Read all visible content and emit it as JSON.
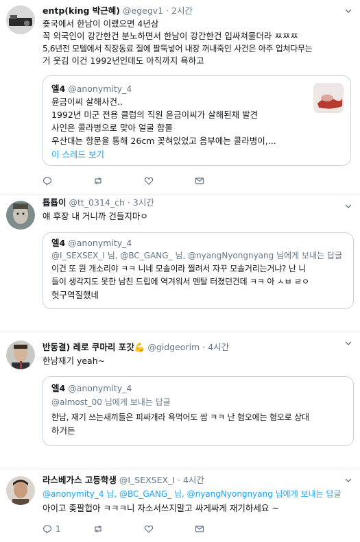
{
  "tweets": [
    {
      "name": "entp(king 박근혜)",
      "handle": "@egegv1",
      "time": "2시간",
      "lines": [
        "죶국에서 한남이 이랬으면 4년삼",
        "꼭 외국인이 강간한건 분노하면서 한남이 강간한건 입싸쳐물더라 ㅉㅉㅉ",
        "5,6년전 모텔에서 직장동료 질에 팔뚝넣어 내장 꺼내죽인 사건은 아주 입쳐다무는",
        "거 웃김 이건 1992년인데도 아직까지 욕하고"
      ],
      "quote": {
        "name": "엘4",
        "handle": "@anonymity_4",
        "lines": [
          "윤금이씨 살해사건..",
          "1992년 미군 전용 클럽의 직원 윤금이씨가 살해된채 발견",
          "사인은 콜라병으로 맞아 얼굴 함몰",
          "우산대는 항문을 통해 26cm 꽂혀있었고 음부에는 콜라병이,..."
        ],
        "thread_link": "이 스레드 보기"
      }
    },
    {
      "name": "툡툡이",
      "handle": "@tt_0314_ch",
      "time": "3시간",
      "lines": [
        "얘 후장 내 거니까 건들지마ㅇ"
      ],
      "quote": {
        "name": "엘4",
        "handle": "@anonymity_4",
        "reply_to": [
          "@I_SEXSEX_I 님, @BC_GANG_ 님, @nyangNyongnyang 님에게 보내는 답글"
        ],
        "lines": [
          "이건 또 뭔 개소리야 ㅋㅋ 니네 모솔이라 찔려서 자꾸 모솔거리는거냐? 난 니",
          "들이 생각지도 못한 남친 드립에 역겨워서 멘탈 터졌던건데 ㅋㅋ 아 ㅅㅂ ㄹㅇ",
          "헛구역질했네"
        ]
      }
    },
    {
      "name": "반동결) 레로 쿠마리 포갓💪",
      "handle": "@gidgeorim",
      "time": "4시간",
      "lines": [
        "한남재기 yeah~"
      ],
      "quote": {
        "name": "엘4",
        "handle": "@anonymity_4",
        "reply_to": [
          "@almost_00 님에게 보내는 답글"
        ],
        "lines": [
          "한남, 재기 쓰는새끼들은 피싸개라 욕먹어도 쌈 ㅋㅋ 난 혐오에는 혐오로 상대",
          "하거든"
        ]
      }
    },
    {
      "name": "라스베가스 고등학생",
      "handle": "@I_SEXSEX_I",
      "time": "4시간",
      "reply_to": "@anonymity_4 님, @BC_GANG_ 님, @nyangNyongnyang 님에게 보내는 답글",
      "lines": [
        "아이고 좆팔헙아 ㅋㅋㅋ니 자소서쓰지말고 싸게싸게 재기하세요 ~"
      ],
      "reply_count": "1"
    }
  ]
}
